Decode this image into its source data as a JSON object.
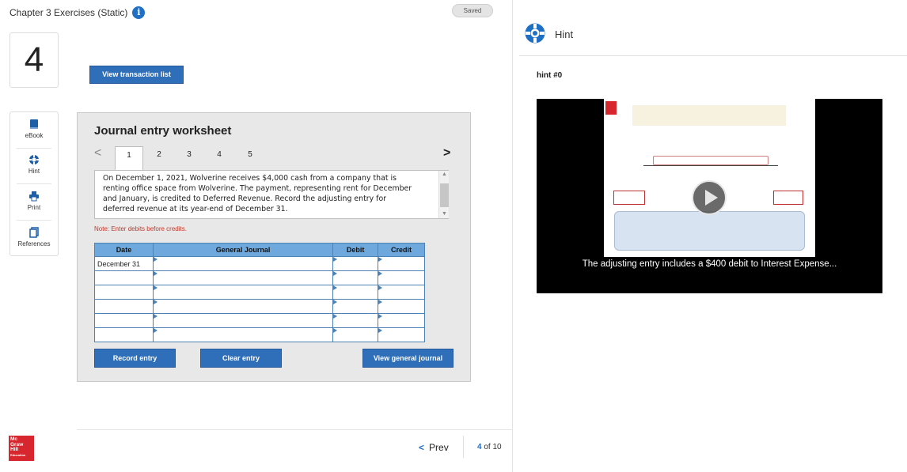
{
  "header": {
    "app_title": "Chapter 3 Exercises (Static)",
    "info_glyph": "i",
    "saved_label": "Saved"
  },
  "question": {
    "number": "4"
  },
  "tools": [
    {
      "label": "eBook",
      "icon": "book-icon"
    },
    {
      "label": "Hint",
      "icon": "lifebuoy-icon"
    },
    {
      "label": "Print",
      "icon": "printer-icon"
    },
    {
      "label": "References",
      "icon": "copy-icon"
    }
  ],
  "view_transaction_label": "View transaction list",
  "worksheet": {
    "title": "Journal entry worksheet",
    "prev_glyph": "<",
    "next_glyph": ">",
    "tabs": [
      "1",
      "2",
      "3",
      "4",
      "5"
    ],
    "active_tab": "1",
    "description": "On December 1, 2021, Wolverine receives $4,000 cash from a company that is renting office space from Wolverine. The payment, representing rent for December and January, is credited to Deferred Revenue. Record the adjusting entry for deferred revenue at its year-end of December 31.",
    "note": "Note: Enter debits before credits.",
    "table": {
      "headers": [
        "Date",
        "General Journal",
        "Debit",
        "Credit"
      ],
      "first_date": "December 31"
    },
    "buttons": {
      "record": "Record entry",
      "clear": "Clear entry",
      "view_journal": "View general journal"
    }
  },
  "pagination": {
    "prev_label": "Prev",
    "current": "4",
    "of_text": "of 10"
  },
  "logo_text": "Mc Graw Hill Education",
  "hint_panel": {
    "title": "Hint",
    "hint_label": "hint #0",
    "caption": "The adjusting entry includes a $400 debit to Interest Expense..."
  },
  "colors": {
    "accent_blue": "#2f6fba",
    "table_header": "#6fa8dc",
    "note_red": "#c0392b",
    "brand_red": "#d7262d"
  }
}
